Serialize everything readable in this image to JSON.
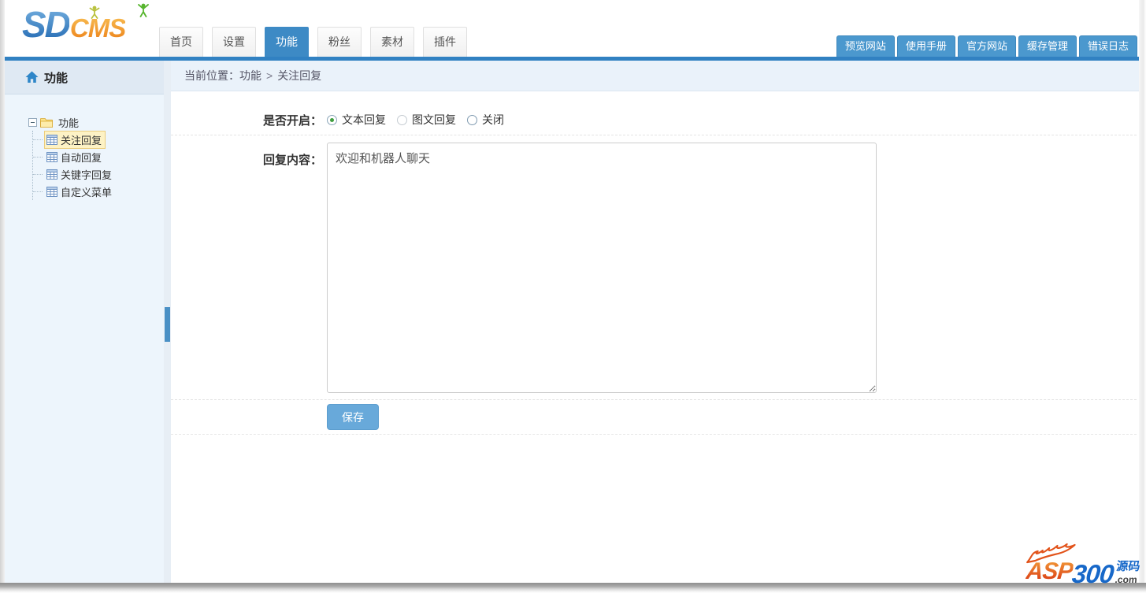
{
  "logo": {
    "sd": "SD",
    "cms": "CMS"
  },
  "nav": {
    "tabs": [
      {
        "label": "首页",
        "active": false
      },
      {
        "label": "设置",
        "active": false
      },
      {
        "label": "功能",
        "active": true
      },
      {
        "label": "粉丝",
        "active": false
      },
      {
        "label": "素材",
        "active": false
      },
      {
        "label": "插件",
        "active": false
      }
    ]
  },
  "quick_links": [
    {
      "label": "预览网站"
    },
    {
      "label": "使用手册"
    },
    {
      "label": "官方网站"
    },
    {
      "label": "缓存管理"
    },
    {
      "label": "错误日志"
    }
  ],
  "sidebar": {
    "title": "功能",
    "tree": {
      "root": "功能",
      "items": [
        {
          "label": "关注回复",
          "selected": true
        },
        {
          "label": "自动回复",
          "selected": false
        },
        {
          "label": "关键字回复",
          "selected": false
        },
        {
          "label": "自定义菜单",
          "selected": false
        }
      ]
    }
  },
  "breadcrumb": {
    "label": "当前位置：",
    "items": [
      "功能",
      "关注回复"
    ],
    "separator": ">"
  },
  "form": {
    "enable_label": "是否开启：",
    "options": [
      {
        "label": "文本回复",
        "checked": true
      },
      {
        "label": "图文回复",
        "checked": false
      },
      {
        "label": "关闭",
        "checked": false
      }
    ],
    "content_label": "回复内容：",
    "content_value": "欢迎和机器人聊天",
    "save_label": "保存"
  },
  "watermark": {
    "asp": "ASP",
    "num": "300",
    "yuanma": "源码",
    "com": ".com"
  },
  "colors": {
    "accent_blue": "#3181c2",
    "active_tab": "#3d8ac5",
    "quick_button": "#4b98ce",
    "save_button": "#68a9da",
    "sidebar_bg": "#edf5fc",
    "selected_highlight": "#fdf2c5",
    "logo_orange": "#ec7f17",
    "logo_blue": "#1e66b0"
  }
}
